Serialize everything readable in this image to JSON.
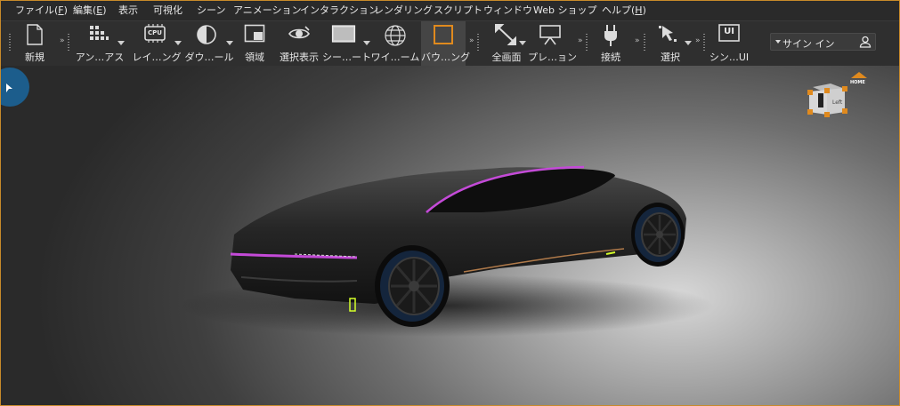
{
  "menu": [
    {
      "label": "ファイル(",
      "key": "F",
      "suffix": ")"
    },
    {
      "label": "編集(",
      "key": "E",
      "suffix": ")"
    },
    {
      "label": "表示",
      "key": "",
      "suffix": ""
    },
    {
      "label": "可視化",
      "key": "",
      "suffix": ""
    },
    {
      "label": "シーン",
      "key": "",
      "suffix": ""
    },
    {
      "label": "アニメーション",
      "key": "",
      "suffix": ""
    },
    {
      "label": "インタラクション",
      "key": "",
      "suffix": ""
    },
    {
      "label": "レンダリング",
      "key": "",
      "suffix": ""
    },
    {
      "label": "スクリプト",
      "key": "",
      "suffix": ""
    },
    {
      "label": "ウィンドウ",
      "key": "",
      "suffix": ""
    },
    {
      "label": "Web ショップ",
      "key": "",
      "suffix": ""
    },
    {
      "label": "ヘルプ(",
      "key": "H",
      "suffix": ")"
    }
  ],
  "toolbar": {
    "new": "新規",
    "anno": "アン…アス",
    "render": "レイ…ング",
    "download": "ダウ…ール",
    "region": "領域",
    "select_display": "選択表示",
    "scene": "シー…ート",
    "wire": "ワイ…ーム",
    "bounding": "バウ…ング",
    "fullscreen": "全画面",
    "presentation": "プレ…ョン",
    "connect": "接続",
    "select": "選択",
    "scene_ui": "シン…UI",
    "cpu_badge": "CPU",
    "ui_badge": "UI"
  },
  "signin": {
    "label": "サイン イン"
  },
  "viewport": {
    "home_label": "HOME",
    "cube_label": "Left"
  },
  "colors": {
    "accent": "#c88a2a",
    "menubar": "#2a2a2a",
    "toolbar": "#2f2f2f",
    "active_tool": "#e08a1e",
    "car_trim": "#c44ad8"
  }
}
